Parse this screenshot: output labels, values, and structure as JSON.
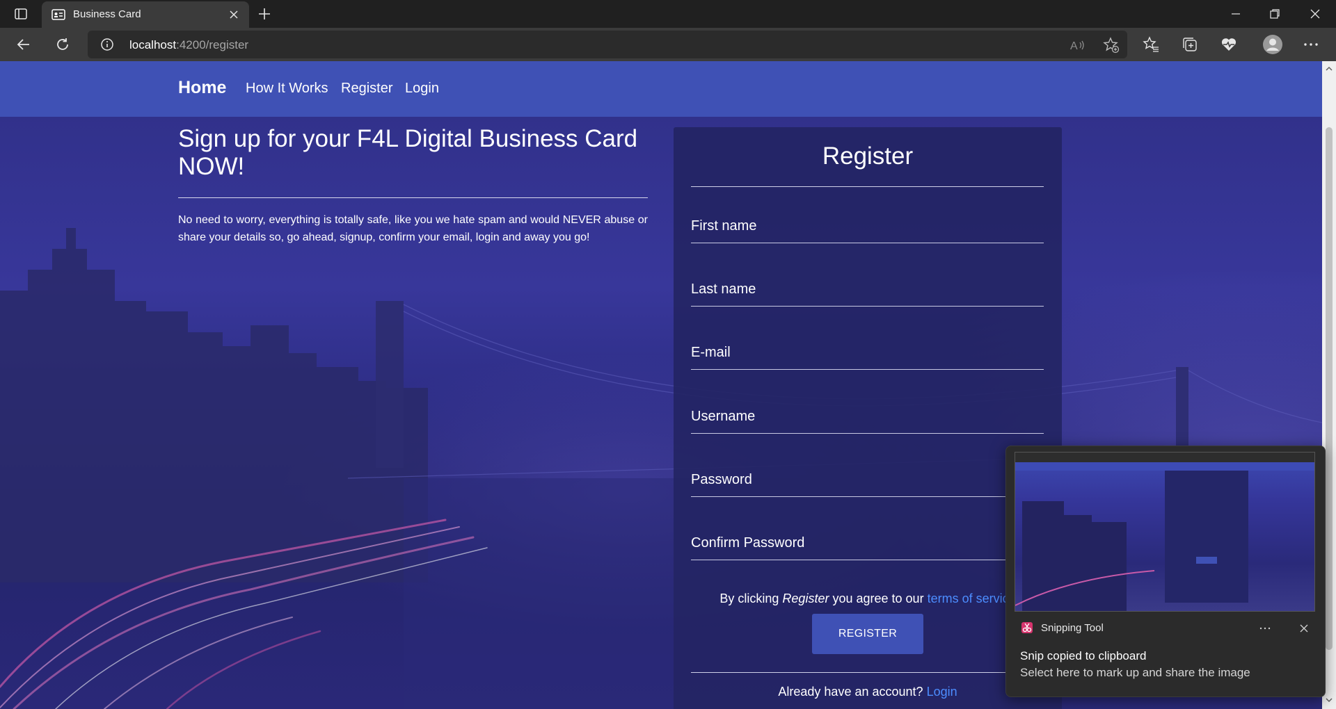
{
  "browser": {
    "tab_title": "Business Card",
    "url_host": "localhost",
    "url_path": ":4200/register"
  },
  "nav": {
    "brand": "Home",
    "links": [
      "How It Works",
      "Register",
      "Login"
    ]
  },
  "hero": {
    "title": "Sign up for your F4L Digital Business Card NOW!",
    "text": "No need to worry, everything is totally safe, like you we hate spam and would NEVER abuse or share your details so, go ahead, signup, confirm your email, login and away you go!"
  },
  "form": {
    "title": "Register",
    "fields": [
      "First name",
      "Last name",
      "E-mail",
      "Username",
      "Password",
      "Confirm Password"
    ],
    "agree_prefix": "By clicking",
    "agree_em": "Register",
    "agree_mid": "you agree to our",
    "agree_link": "terms of service",
    "submit": "REGISTER",
    "already": "Already have an account?",
    "login_link": "Login"
  },
  "toast": {
    "app": "Snipping Tool",
    "title": "Snip copied to clipboard",
    "body": "Select here to mark up and share the image"
  },
  "colors": {
    "navbar": "#3f51b5",
    "link": "#4c8dff",
    "card": "#232564"
  }
}
